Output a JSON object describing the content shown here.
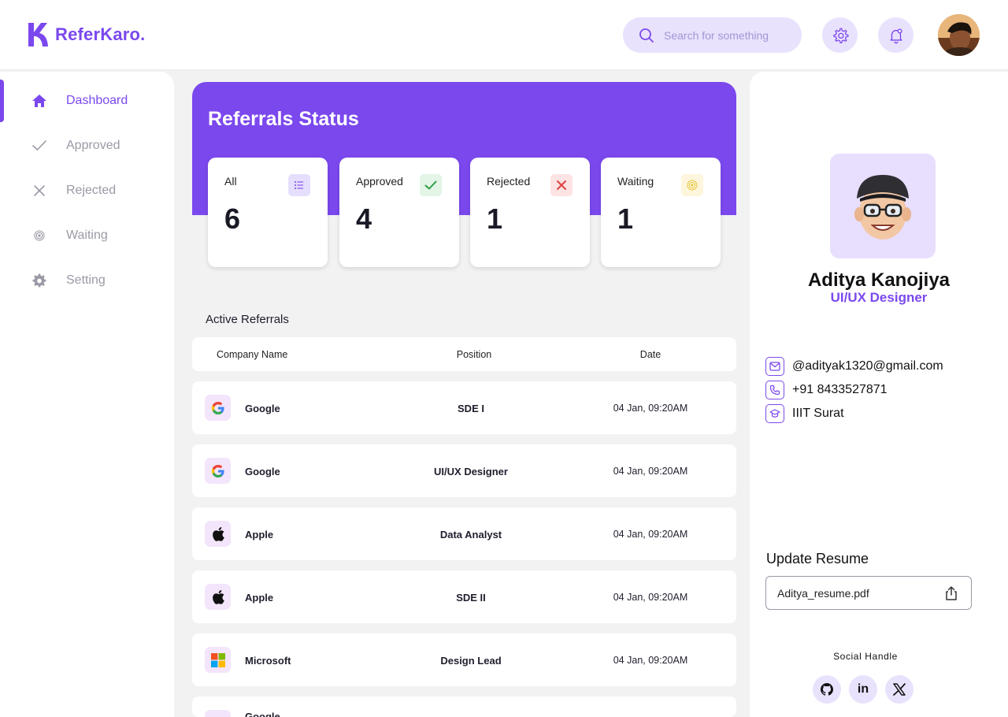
{
  "app": {
    "logo_text": "ReferKaro.",
    "brand_color": "#7b48ee"
  },
  "header": {
    "search": {
      "placeholder": "Search for something",
      "icon": "search-icon"
    },
    "settings_icon": "gear-icon",
    "notifications_icon": "bell-icon",
    "avatar": "user-avatar"
  },
  "sidebar": {
    "items": [
      {
        "label": "Dashboard",
        "icon": "home-icon",
        "active": true
      },
      {
        "label": "Approved",
        "icon": "check-icon",
        "active": false
      },
      {
        "label": "Rejected",
        "icon": "close-icon",
        "active": false
      },
      {
        "label": "Waiting",
        "icon": "target-icon",
        "active": false
      },
      {
        "label": "Setting",
        "icon": "gear-icon",
        "active": false
      }
    ]
  },
  "status": {
    "title": "Referrals Status",
    "cards": [
      {
        "label": "All",
        "value": "6",
        "icon": "list-icon",
        "icon_bg": "#e6defd",
        "icon_color": "#7b48ee"
      },
      {
        "label": "Approved",
        "value": "4",
        "icon": "check-icon",
        "icon_bg": "#e3f5e6",
        "icon_color": "#2e9e47"
      },
      {
        "label": "Rejected",
        "value": "1",
        "icon": "close-icon",
        "icon_bg": "#fde3e3",
        "icon_color": "#e04242"
      },
      {
        "label": "Waiting",
        "value": "1",
        "icon": "target-icon",
        "icon_bg": "#fdf6dc",
        "icon_color": "#e6c53c"
      }
    ]
  },
  "referrals": {
    "title": "Active Referrals",
    "columns": [
      "Company Name",
      "Position",
      "Date"
    ],
    "rows": [
      {
        "company": "Google",
        "logo": "google-logo",
        "position": "SDE I",
        "date": "04 Jan, 09:20AM"
      },
      {
        "company": "Google",
        "logo": "google-logo",
        "position": "UI/UX Designer",
        "date": "04 Jan, 09:20AM"
      },
      {
        "company": "Apple",
        "logo": "apple-logo",
        "position": "Data Analyst",
        "date": "04 Jan, 09:20AM"
      },
      {
        "company": "Apple",
        "logo": "apple-logo",
        "position": "SDE II",
        "date": "04 Jan, 09:20AM"
      },
      {
        "company": "Microsoft",
        "logo": "microsoft-logo",
        "position": "Design Lead",
        "date": "04 Jan, 09:20AM"
      },
      {
        "company": "Google",
        "logo": "google-logo",
        "position": "",
        "date": ""
      }
    ]
  },
  "profile": {
    "name": "Aditya Kanojiya",
    "role": "UI/UX Designer",
    "email": "@adityak1320@gmail.com",
    "phone": "+91 8433527871",
    "college": "IIIT Surat",
    "resume_title": "Update Resume",
    "resume_file": "Aditya_resume.pdf",
    "social_title": "Social Handle",
    "socials": [
      "github-icon",
      "linkedin-icon",
      "x-icon"
    ]
  }
}
